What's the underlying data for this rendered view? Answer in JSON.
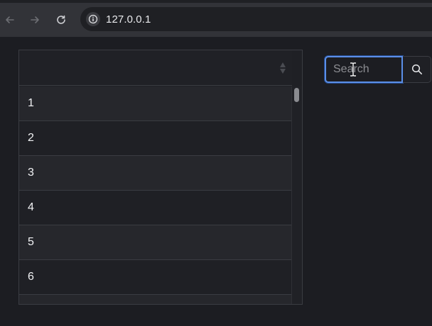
{
  "browser": {
    "url": "127.0.0.1",
    "icons": {
      "back": "arrow-left-icon",
      "forward": "arrow-right-icon",
      "reload": "reload-icon",
      "site_info": "info-icon"
    }
  },
  "list": {
    "items": [
      {
        "label": "1"
      },
      {
        "label": "2"
      },
      {
        "label": "3"
      },
      {
        "label": "4"
      },
      {
        "label": "5"
      },
      {
        "label": "6"
      },
      {
        "label": ""
      }
    ]
  },
  "search": {
    "placeholder": "Search",
    "value": ""
  },
  "colors": {
    "background": "#1c1d22",
    "focus_ring": "#5b8fe8",
    "row_odd": "#26272c",
    "row_even": "#1f2025"
  }
}
